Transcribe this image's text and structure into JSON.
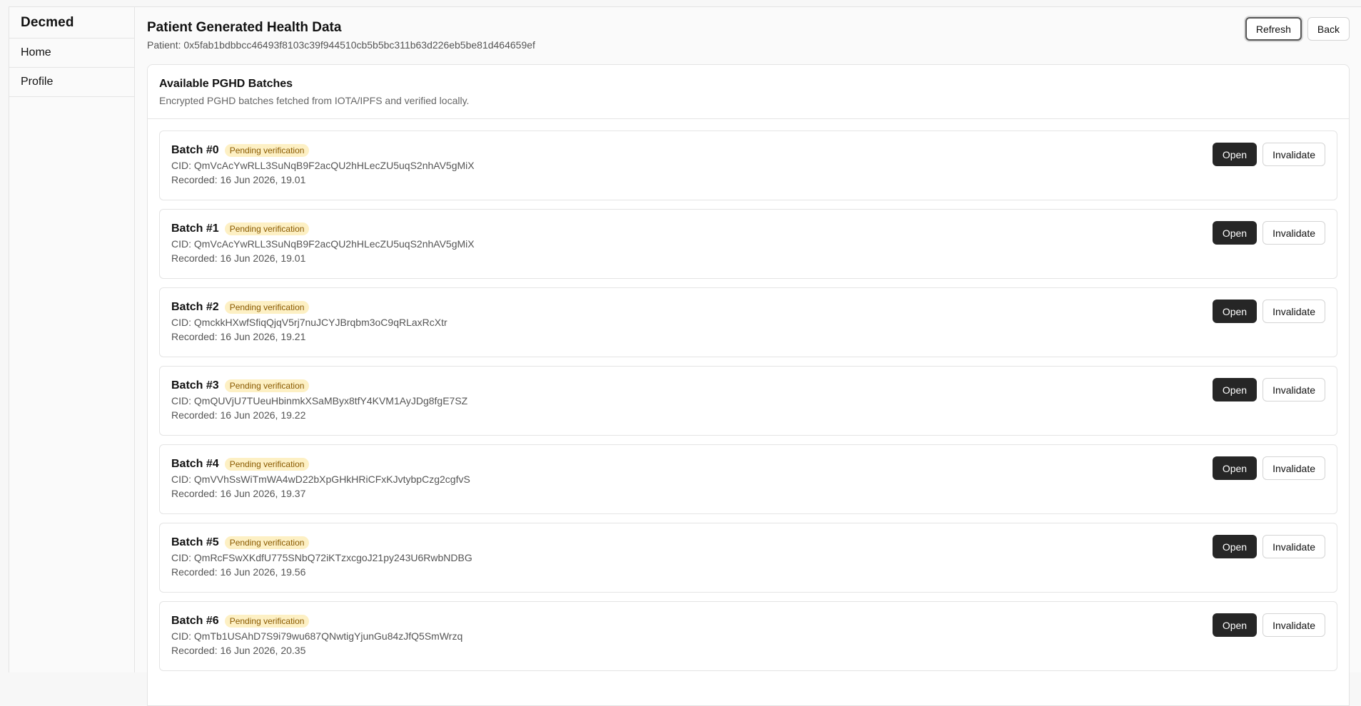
{
  "sidebar": {
    "brand": "Decmed",
    "items": [
      {
        "label": "Home"
      },
      {
        "label": "Profile"
      }
    ]
  },
  "header": {
    "title": "Patient Generated Health Data",
    "patient": "Patient: 0x5fab1bdbbcc46493f8103c39f944510cb5b5bc311b63d226eb5be81d464659ef",
    "refresh_label": "Refresh",
    "back_label": "Back"
  },
  "card": {
    "title": "Available PGHD Batches",
    "description": "Encrypted PGHD batches fetched from IOTA/IPFS and verified locally."
  },
  "batch_actions": {
    "open_label": "Open",
    "invalidate_label": "Invalidate"
  },
  "batches": [
    {
      "title": "Batch #0",
      "status": "Pending verification",
      "cid": "CID: QmVcAcYwRLL3SuNqB9F2acQU2hHLecZU5uqS2nhAV5gMiX",
      "recorded": "Recorded: 16 Jun 2026, 19.01"
    },
    {
      "title": "Batch #1",
      "status": "Pending verification",
      "cid": "CID: QmVcAcYwRLL3SuNqB9F2acQU2hHLecZU5uqS2nhAV5gMiX",
      "recorded": "Recorded: 16 Jun 2026, 19.01"
    },
    {
      "title": "Batch #2",
      "status": "Pending verification",
      "cid": "CID: QmckkHXwfSfiqQjqV5rj7nuJCYJBrqbm3oC9qRLaxRcXtr",
      "recorded": "Recorded: 16 Jun 2026, 19.21"
    },
    {
      "title": "Batch #3",
      "status": "Pending verification",
      "cid": "CID: QmQUVjU7TUeuHbinmkXSaMByx8tfY4KVM1AyJDg8fgE7SZ",
      "recorded": "Recorded: 16 Jun 2026, 19.22"
    },
    {
      "title": "Batch #4",
      "status": "Pending verification",
      "cid": "CID: QmVVhSsWiTmWA4wD22bXpGHkHRiCFxKJvtybpCzg2cgfvS",
      "recorded": "Recorded: 16 Jun 2026, 19.37"
    },
    {
      "title": "Batch #5",
      "status": "Pending verification",
      "cid": "CID: QmRcFSwXKdfU775SNbQ72iKTzxcgoJ21py243U6RwbNDBG",
      "recorded": "Recorded: 16 Jun 2026, 19.56"
    },
    {
      "title": "Batch #6",
      "status": "Pending verification",
      "cid": "CID: QmTb1USAhD7S9i79wu687QNwtigYjunGu84zJfQ5SmWrzq",
      "recorded": "Recorded: 16 Jun 2026, 20.35"
    }
  ]
}
